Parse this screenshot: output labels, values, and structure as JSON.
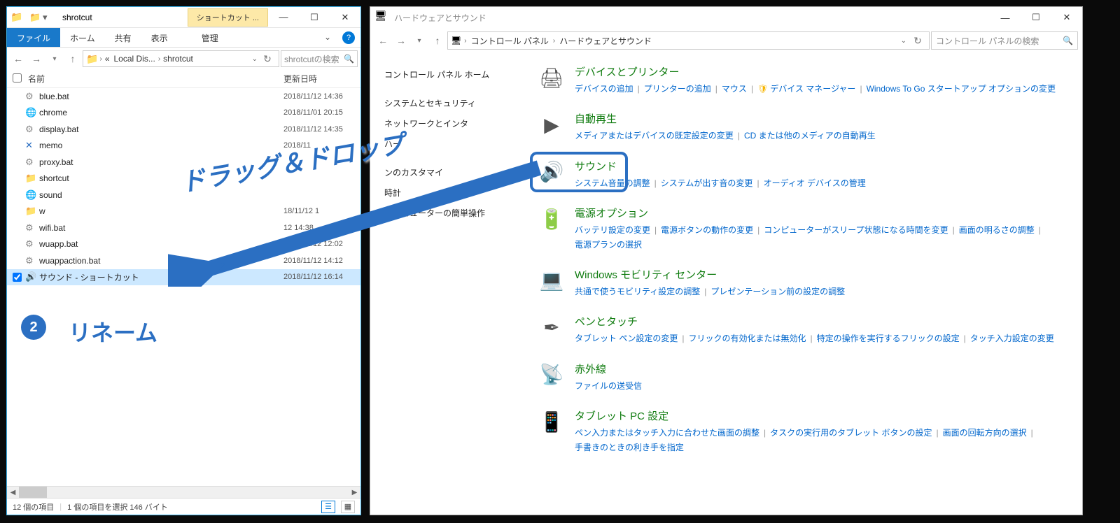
{
  "explorer": {
    "title": "shrotcut",
    "context_tab": "ショートカット ...",
    "ribbon": {
      "file": "ファイル",
      "home": "ホーム",
      "share": "共有",
      "view": "表示",
      "manage": "管理"
    },
    "breadcrumb": [
      "«",
      "Local Dis...",
      "shrotcut"
    ],
    "search_placeholder": "shrotcutの検索",
    "columns": {
      "name": "名前",
      "date": "更新日時"
    },
    "files": [
      {
        "icon": "⚙",
        "name": "blue.bat",
        "date": "2018/11/12 14:36",
        "color": "#888"
      },
      {
        "icon": "🌐",
        "name": "chrome",
        "date": "2018/11/01 20:15",
        "color": "#e8443a"
      },
      {
        "icon": "⚙",
        "name": "display.bat",
        "date": "2018/11/12 14:35",
        "color": "#888"
      },
      {
        "icon": "✕",
        "name": "memo",
        "date": "2018/11",
        "color": "#2b6fc2"
      },
      {
        "icon": "⚙",
        "name": "proxy.bat",
        "date": "",
        "color": "#888"
      },
      {
        "icon": "📁",
        "name": "shortcut",
        "date": "",
        "color": "#e8a33d"
      },
      {
        "icon": "🌐",
        "name": "sound",
        "date": "",
        "color": "#e8443a"
      },
      {
        "icon": "📁",
        "name": "w",
        "date": "18/11/12 1",
        "color": "#e8a33d"
      },
      {
        "icon": "⚙",
        "name": "wifi.bat",
        "date": "12 14:38",
        "color": "#888"
      },
      {
        "icon": "⚙",
        "name": "wuapp.bat",
        "date": "2018/11/12 12:02",
        "color": "#888"
      },
      {
        "icon": "⚙",
        "name": "wuappaction.bat",
        "date": "2018/11/12 14:12",
        "color": "#888"
      },
      {
        "icon": "🔊",
        "name": "サウンド - ショートカット",
        "date": "2018/11/12 16:14",
        "selected": true,
        "color": "#666"
      }
    ],
    "status": {
      "count": "12 個の項目",
      "sel": "1 個の項目を選択 146 バイト"
    }
  },
  "cp": {
    "title": "ハードウェアとサウンド",
    "breadcrumb": [
      "コントロール パネル",
      "ハードウェアとサウンド"
    ],
    "search_placeholder": "コントロール パネルの検索",
    "side": {
      "home": "コントロール パネル ホーム",
      "items": [
        "システムとセキュリティ",
        "ネットワークとインタ",
        "ハー",
        "",
        "ンのカスタマイ",
        "時計",
        "コンピューターの簡単操作"
      ]
    },
    "cats": [
      {
        "icon": "🖨",
        "title": "デバイスとプリンター",
        "links": [
          "デバイスの追加",
          "プリンターの追加",
          "マウス",
          "デバイス マネージャー",
          "Windows To Go スタートアップ オプションの変更"
        ],
        "shield": [
          3
        ]
      },
      {
        "icon": "▶",
        "title": "自動再生",
        "links": [
          "メディアまたはデバイスの既定設定の変更",
          "CD または他のメディアの自動再生"
        ]
      },
      {
        "icon": "🔊",
        "title": "サウンド",
        "links": [
          "システム音量の調整",
          "システムが出す音の変更",
          "オーディオ デバイスの管理"
        ],
        "highlight": true
      },
      {
        "icon": "🔋",
        "title": "電源オプション",
        "links": [
          "バッテリ設定の変更",
          "電源ボタンの動作の変更",
          "コンピューターがスリープ状態になる時間を変更",
          "画面の明るさの調整",
          "電源プランの選択"
        ]
      },
      {
        "icon": "💻",
        "title": "Windows モビリティ センター",
        "links": [
          "共通で使うモビリティ設定の調整",
          "プレゼンテーション前の設定の調整"
        ]
      },
      {
        "icon": "✒",
        "title": "ペンとタッチ",
        "links": [
          "タブレット ペン設定の変更",
          "フリックの有効化または無効化",
          "特定の操作を実行するフリックの設定",
          "タッチ入力設定の変更"
        ]
      },
      {
        "icon": "📡",
        "title": "赤外線",
        "links": [
          "ファイルの送受信"
        ]
      },
      {
        "icon": "📱",
        "title": "タブレット PC 設定",
        "links": [
          "ペン入力またはタッチ入力に合わせた画面の調整",
          "タスクの実行用のタブレット ボタンの設定",
          "画面の回転方向の選択",
          "手書きのときの利き手を指定"
        ]
      }
    ]
  },
  "anno": {
    "drag": "ドラッグ＆ドロップ",
    "step2": "2",
    "rename": "リネーム"
  }
}
